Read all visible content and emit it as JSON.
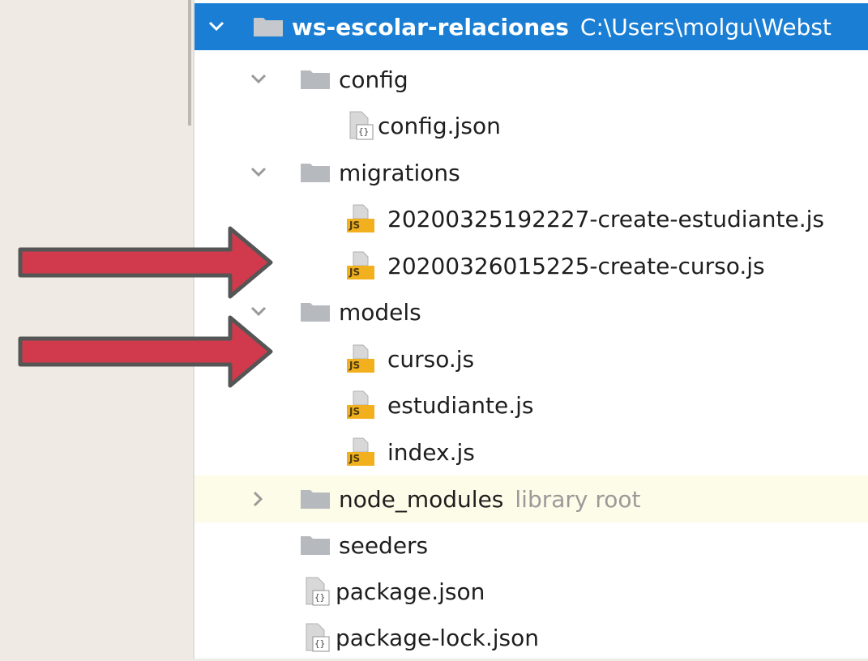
{
  "tree": {
    "root": {
      "name": "ws-escolar-relaciones",
      "path": "C:\\Users\\molgu\\Webst"
    },
    "config_folder": "config",
    "config_json": "config.json",
    "migrations_folder": "migrations",
    "migration_1": "20200325192227-create-estudiante.js",
    "migration_2": "20200326015225-create-curso.js",
    "models_folder": "models",
    "model_curso": "curso.js",
    "model_estudiante": "estudiante.js",
    "model_index": "index.js",
    "node_modules_folder": "node_modules",
    "node_modules_badge": "library root",
    "seeders_folder": "seeders",
    "package_json": "package.json",
    "package_lock_json": "package-lock.json"
  },
  "icons": {
    "js_badge": "JS",
    "json_badge": "{}"
  },
  "colors": {
    "selection": "#1a7fd4",
    "highlight_row": "#fdfce8",
    "arrow_fill": "#d13a4c",
    "arrow_stroke": "#555555",
    "js_icon": "#f2b01e",
    "folder_icon": "#b6b9bd"
  }
}
